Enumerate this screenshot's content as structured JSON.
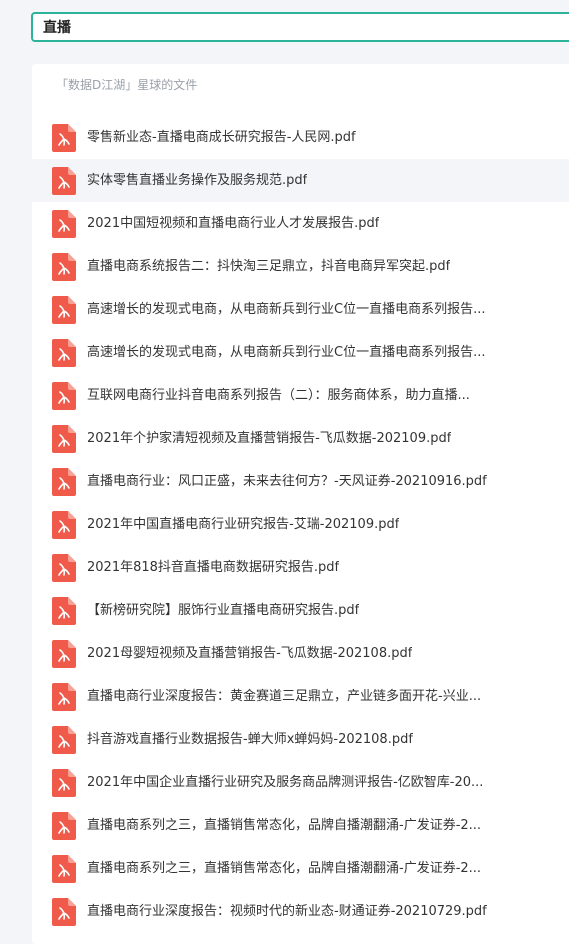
{
  "search": {
    "value": "直播"
  },
  "panel": {
    "header": "「数据D江湖」星球的文件"
  },
  "colors": {
    "accent": "#2bb49a",
    "pdf_icon": "#ef5a4a",
    "hover_row": "#f3f5f8"
  },
  "files": [
    {
      "name": "零售新业态-直播电商成长研究报告-人民网.pdf",
      "icon": "pdf-icon",
      "highlighted": false
    },
    {
      "name": "实体零售直播业务操作及服务规范.pdf",
      "icon": "pdf-icon",
      "highlighted": true
    },
    {
      "name": "2021中国短视频和直播电商行业人才发展报告.pdf",
      "icon": "pdf-icon",
      "highlighted": false
    },
    {
      "name": "直播电商系统报告二：抖快淘三足鼎立，抖音电商异军突起.pdf",
      "icon": "pdf-icon",
      "highlighted": false
    },
    {
      "name": "高速增长的发现式电商，从电商新兵到行业C位一直播电商系列报告...",
      "icon": "pdf-icon",
      "highlighted": false
    },
    {
      "name": "高速增长的发现式电商，从电商新兵到行业C位一直播电商系列报告...",
      "icon": "pdf-icon",
      "highlighted": false
    },
    {
      "name": "互联网电商行业抖音电商系列报告（二）：服务商体系，助力直播...",
      "icon": "pdf-icon",
      "highlighted": false
    },
    {
      "name": "2021年个护家清短视频及直播营销报告-飞瓜数据-202109.pdf",
      "icon": "pdf-icon",
      "highlighted": false
    },
    {
      "name": "直播电商行业：风口正盛，未来去往何方？-天风证券-20210916.pdf",
      "icon": "pdf-icon",
      "highlighted": false
    },
    {
      "name": "2021年中国直播电商行业研究报告-艾瑞-202109.pdf",
      "icon": "pdf-icon",
      "highlighted": false
    },
    {
      "name": "2021年818抖音直播电商数据研究报告.pdf",
      "icon": "pdf-icon",
      "highlighted": false
    },
    {
      "name": "【新榜研究院】服饰行业直播电商研究报告.pdf",
      "icon": "pdf-icon",
      "highlighted": false
    },
    {
      "name": "2021母婴短视频及直播营销报告-飞瓜数据-202108.pdf",
      "icon": "pdf-icon",
      "highlighted": false
    },
    {
      "name": "直播电商行业深度报告：黄金赛道三足鼎立，产业链多面开花-兴业...",
      "icon": "pdf-icon",
      "highlighted": false
    },
    {
      "name": "抖音游戏直播行业数据报告-蝉大师x蝉妈妈-202108.pdf",
      "icon": "pdf-icon",
      "highlighted": false
    },
    {
      "name": "2021年中国企业直播行业研究及服务商品牌测评报告-亿欧智库-20...",
      "icon": "pdf-icon",
      "highlighted": false
    },
    {
      "name": "直播电商系列之三，直播销售常态化，品牌自播潮翻涌-广发证券-2...",
      "icon": "pdf-icon",
      "highlighted": false
    },
    {
      "name": "直播电商系列之三，直播销售常态化，品牌自播潮翻涌-广发证券-2...",
      "icon": "pdf-icon",
      "highlighted": false
    },
    {
      "name": "直播电商行业深度报告：视频时代的新业态-财通证券-20210729.pdf",
      "icon": "pdf-icon",
      "highlighted": false
    }
  ]
}
